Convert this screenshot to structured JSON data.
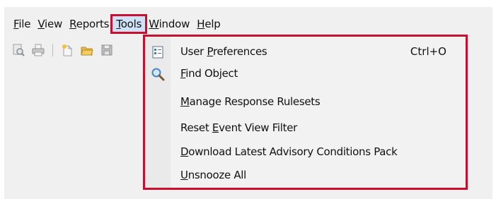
{
  "menubar": {
    "items": [
      {
        "pre": "",
        "mn": "F",
        "post": "ile"
      },
      {
        "pre": "",
        "mn": "V",
        "post": "iew"
      },
      {
        "pre": "",
        "mn": "R",
        "post": "eports"
      },
      {
        "pre": "",
        "mn": "T",
        "post": "ools"
      },
      {
        "pre": "",
        "mn": "W",
        "post": "indow"
      },
      {
        "pre": "",
        "mn": "H",
        "post": "elp"
      }
    ],
    "active_item": "Tools"
  },
  "toolbar": {
    "buttons": [
      "print-preview-icon",
      "print-icon",
      "new-icon",
      "open-folder-icon",
      "save-icon"
    ]
  },
  "tools_menu": {
    "items": [
      {
        "pre": "User ",
        "mn": "P",
        "post": "references",
        "shortcut": "Ctrl+O",
        "icon": "preferences-icon"
      },
      {
        "pre": "",
        "mn": "F",
        "post": "ind Object",
        "shortcut": "",
        "icon": "magnifier-icon"
      },
      {
        "pre": "",
        "mn": "M",
        "post": "anage Response Rulesets",
        "shortcut": "",
        "icon": ""
      },
      {
        "pre": "Reset ",
        "mn": "E",
        "post": "vent View Filter",
        "shortcut": "",
        "icon": ""
      },
      {
        "pre": "",
        "mn": "D",
        "post": "ownload Latest Advisory Conditions Pack",
        "shortcut": "",
        "icon": ""
      },
      {
        "pre": "",
        "mn": "U",
        "post": "nsnooze All",
        "shortcut": "",
        "icon": ""
      }
    ]
  },
  "colors": {
    "highlight_border": "#c8102e",
    "active_menu_bg": "#cfe2f7",
    "menu_bg": "#f2f2f2"
  }
}
